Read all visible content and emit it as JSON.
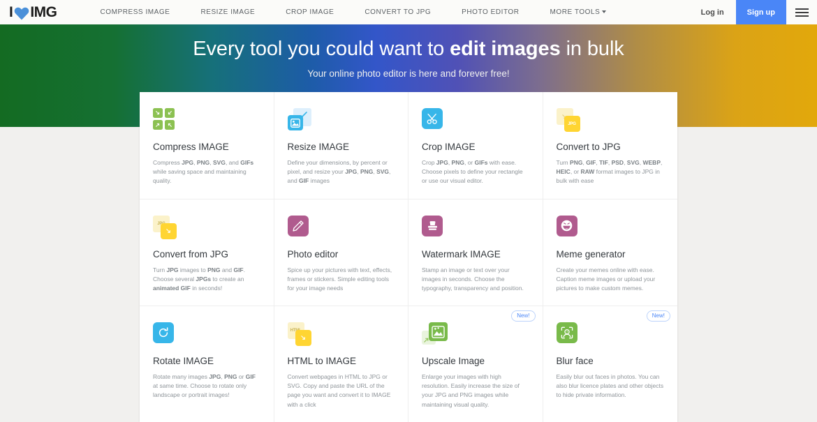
{
  "header": {
    "logo_text_left": "I",
    "logo_text_right": "IMG",
    "logo_icon": "heart-icon",
    "nav": [
      {
        "label": "COMPRESS IMAGE",
        "name": "nav-compress-image"
      },
      {
        "label": "RESIZE IMAGE",
        "name": "nav-resize-image"
      },
      {
        "label": "CROP IMAGE",
        "name": "nav-crop-image"
      },
      {
        "label": "CONVERT TO JPG",
        "name": "nav-convert-to-jpg"
      },
      {
        "label": "PHOTO EDITOR",
        "name": "nav-photo-editor"
      },
      {
        "label": "MORE TOOLS",
        "name": "nav-more-tools",
        "has_caret": true
      }
    ],
    "login_label": "Log in",
    "signup_label": "Sign up",
    "signup_color": "#4a86f7",
    "menu_icon": "hamburger-menu-icon"
  },
  "hero": {
    "title_part1": "Every tool you could want to ",
    "title_part2": "edit images",
    "title_part3": " in bulk",
    "subtitle": "Your online photo editor is here and forever free!",
    "gradient_start": "#146b22",
    "gradient_mid": "#3356c9",
    "gradient_end": "#e2a80b"
  },
  "tools": [
    {
      "title": "Compress IMAGE",
      "desc_html": "Compress <b>JPG</b>, <b>PNG</b>, <b>SVG</b>, and <b>GIFs</b> while saving space and maintaining quality.",
      "icon": "compress-icon",
      "color": "#8cc152",
      "new": false
    },
    {
      "title": "Resize IMAGE",
      "desc_html": "Define your dimensions, by percent or pixel, and resize your <b>JPG</b>, <b>PNG</b>, <b>SVG</b>, and <b>GIF</b> images",
      "icon": "resize-icon",
      "color": "#37b6e9",
      "new": false
    },
    {
      "title": "Crop IMAGE",
      "desc_html": "Crop <b>JPG</b>, <b>PNG</b>, or <b>GIFs</b> with ease. Choose pixels to define your rectangle or use our visual editor.",
      "icon": "scissors-icon",
      "color": "#37b6e9",
      "new": false
    },
    {
      "title": "Convert to JPG",
      "desc_html": "Turn <b>PNG</b>, <b>GIF</b>, <b>TIF</b>, <b>PSD</b>, <b>SVG</b>, <b>WEBP</b>, <b>HEIC</b>, or <b>RAW</b> format images to JPG in bulk with ease",
      "icon": "convert-to-jpg-icon",
      "color": "#ffd532",
      "new": false
    },
    {
      "title": "Convert from JPG",
      "desc_html": "Turn <b>JPG</b> images to <b>PNG</b> and <b>GIF</b>. Choose several <b>JPGs</b> to create an <b>animated GIF</b> in seconds!",
      "icon": "convert-from-jpg-icon",
      "color": "#ffd532",
      "new": false
    },
    {
      "title": "Photo editor",
      "desc_html": "Spice up your pictures with text, effects, frames or stickers. Simple editing tools for your image needs",
      "icon": "pencil-icon",
      "color": "#b05b8e",
      "new": false
    },
    {
      "title": "Watermark IMAGE",
      "desc_html": "Stamp an image or text over your images in seconds. Choose the typography, transparency and position.",
      "icon": "stamp-icon",
      "color": "#b05b8e",
      "new": false
    },
    {
      "title": "Meme generator",
      "desc_html": "Create your memes online with ease. Caption meme images or upload your pictures to make custom memes.",
      "icon": "laughing-face-icon",
      "color": "#b05b8e",
      "new": false
    },
    {
      "title": "Rotate IMAGE",
      "desc_html": "Rotate many images <b>JPG</b>, <b>PNG</b> or <b>GIF</b> at same time. Choose to rotate only landscape or portrait images!",
      "icon": "rotate-icon",
      "color": "#37b6e9",
      "new": false
    },
    {
      "title": "HTML to IMAGE",
      "desc_html": "Convert webpages in HTML to JPG or SVG. Copy and paste the URL of the page you want and convert it to IMAGE with a click",
      "icon": "html-to-image-icon",
      "color": "#ffd532",
      "new": false
    },
    {
      "title": "Upscale Image",
      "desc_html": "Enlarge your images with high resolution. Easily increase the size of your JPG and PNG images while maintaining visual quality.",
      "icon": "upscale-icon",
      "color": "#79ba4a",
      "new": true,
      "badge": "New!"
    },
    {
      "title": "Blur face",
      "desc_html": "Easily blur out faces in photos. You can also blur licence plates and other objects to hide private information.",
      "icon": "blur-face-icon",
      "color": "#79ba4a",
      "new": true,
      "badge": "New!"
    }
  ]
}
